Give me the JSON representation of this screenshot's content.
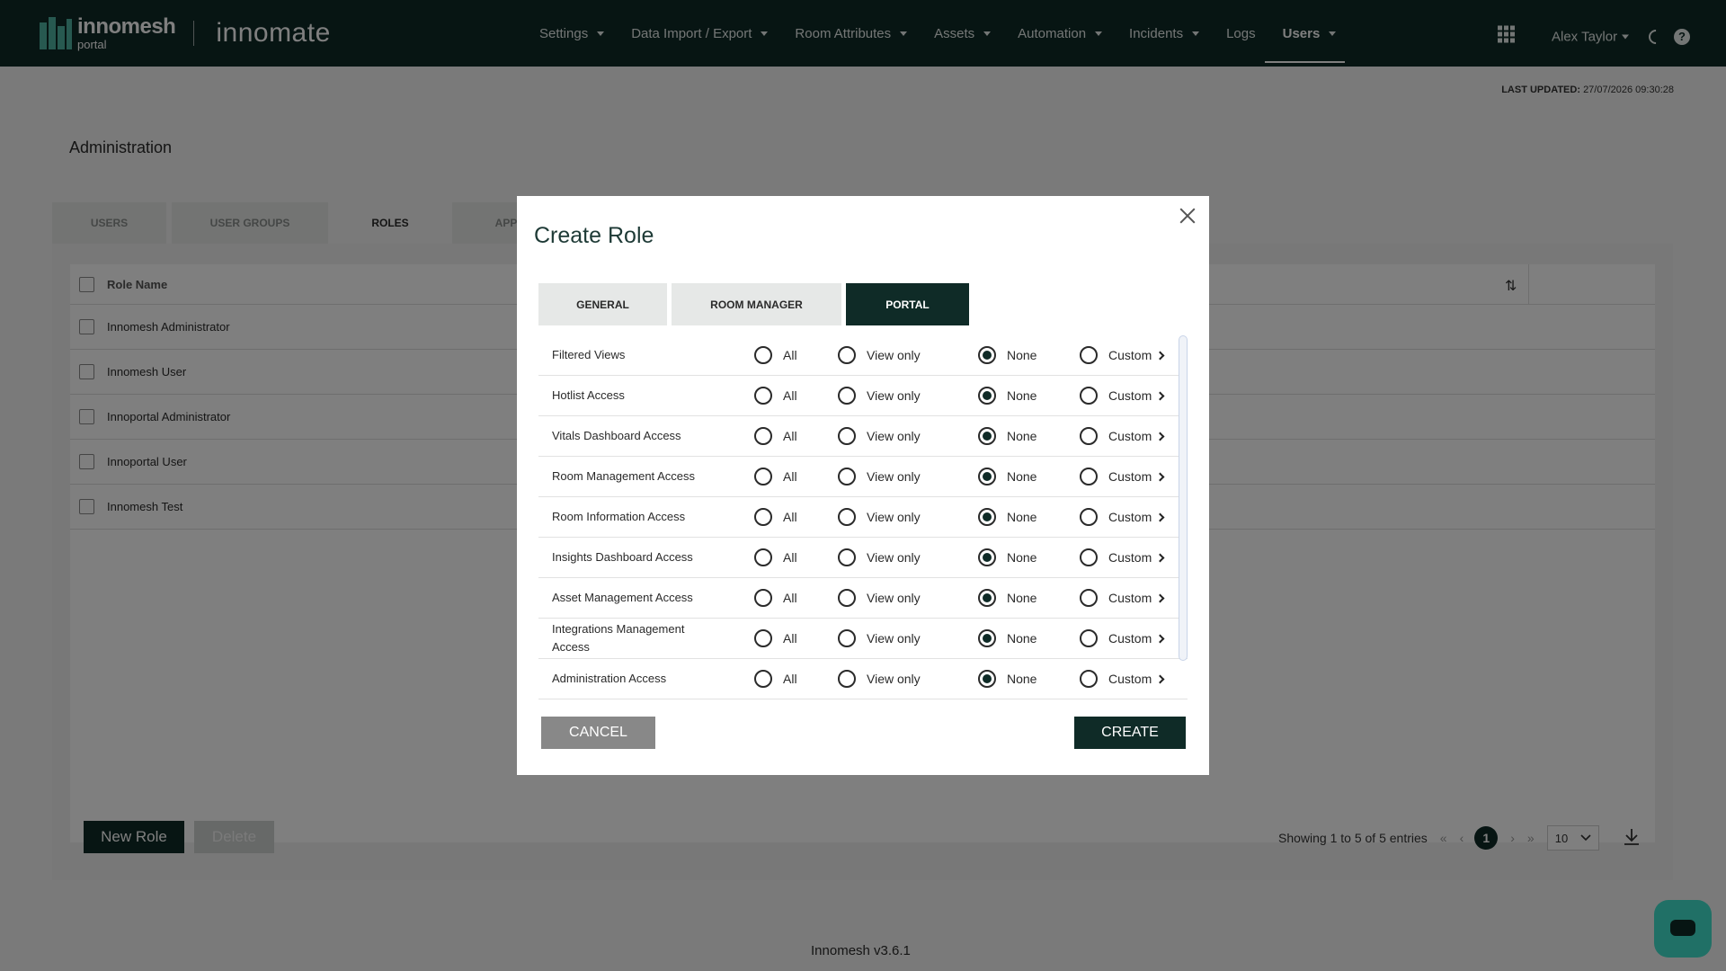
{
  "app": {
    "brand": "innomesh",
    "brand_sub": "portal",
    "product": "innomate",
    "version": "Innomesh v3.6.1"
  },
  "nav": {
    "items": [
      {
        "label": "Settings",
        "dropdown": true
      },
      {
        "label": "Data Import / Export",
        "dropdown": true
      },
      {
        "label": "Room Attributes",
        "dropdown": true
      },
      {
        "label": "Assets",
        "dropdown": true
      },
      {
        "label": "Automation",
        "dropdown": true
      },
      {
        "label": "Incidents",
        "dropdown": true
      },
      {
        "label": "Logs",
        "dropdown": false
      },
      {
        "label": "Users",
        "dropdown": true,
        "active": true
      }
    ],
    "user": "Alex Taylor",
    "help": "?"
  },
  "last_updated": {
    "label": "LAST UPDATED:",
    "value": "27/07/2026 09:30:28"
  },
  "page": {
    "title": "Administration",
    "tabs": [
      "USERS",
      "USER GROUPS",
      "ROLES",
      "APP"
    ],
    "active_tab": "ROLES"
  },
  "roles_table": {
    "header": "Role Name",
    "rows": [
      "Innomesh Administrator",
      "Innomesh User",
      "Innoportal Administrator",
      "Innoportal User",
      "Innomesh Test"
    ]
  },
  "actions": {
    "new_role": "New Role",
    "delete": "Delete"
  },
  "pagination": {
    "summary": "Showing 1 to 5 of 5 entries",
    "first": "«",
    "prev": "‹",
    "current": "1",
    "next": "›",
    "last": "»",
    "page_size": "10"
  },
  "modal": {
    "title": "Create Role",
    "tabs": [
      "GENERAL",
      "ROOM MANAGER",
      "PORTAL"
    ],
    "active_tab": "PORTAL",
    "options": [
      "All",
      "View only",
      "None",
      "Custom"
    ],
    "permissions": [
      {
        "label": "Filtered Views",
        "selected": "None"
      },
      {
        "label": "Hotlist Access",
        "selected": "None"
      },
      {
        "label": "Vitals Dashboard Access",
        "selected": "None"
      },
      {
        "label": "Room Management Access",
        "selected": "None"
      },
      {
        "label": "Room Information Access",
        "selected": "None"
      },
      {
        "label": "Insights Dashboard Access",
        "selected": "None"
      },
      {
        "label": "Asset Management Access",
        "selected": "None"
      },
      {
        "label": "Integrations Management Access",
        "selected": "None"
      },
      {
        "label": "Administration Access",
        "selected": "None"
      }
    ],
    "cancel": "CANCEL",
    "create": "CREATE"
  },
  "colors": {
    "brand_dark": "#0f2b27",
    "accent": "#4fb3a1",
    "chat": "#41e0cc"
  }
}
